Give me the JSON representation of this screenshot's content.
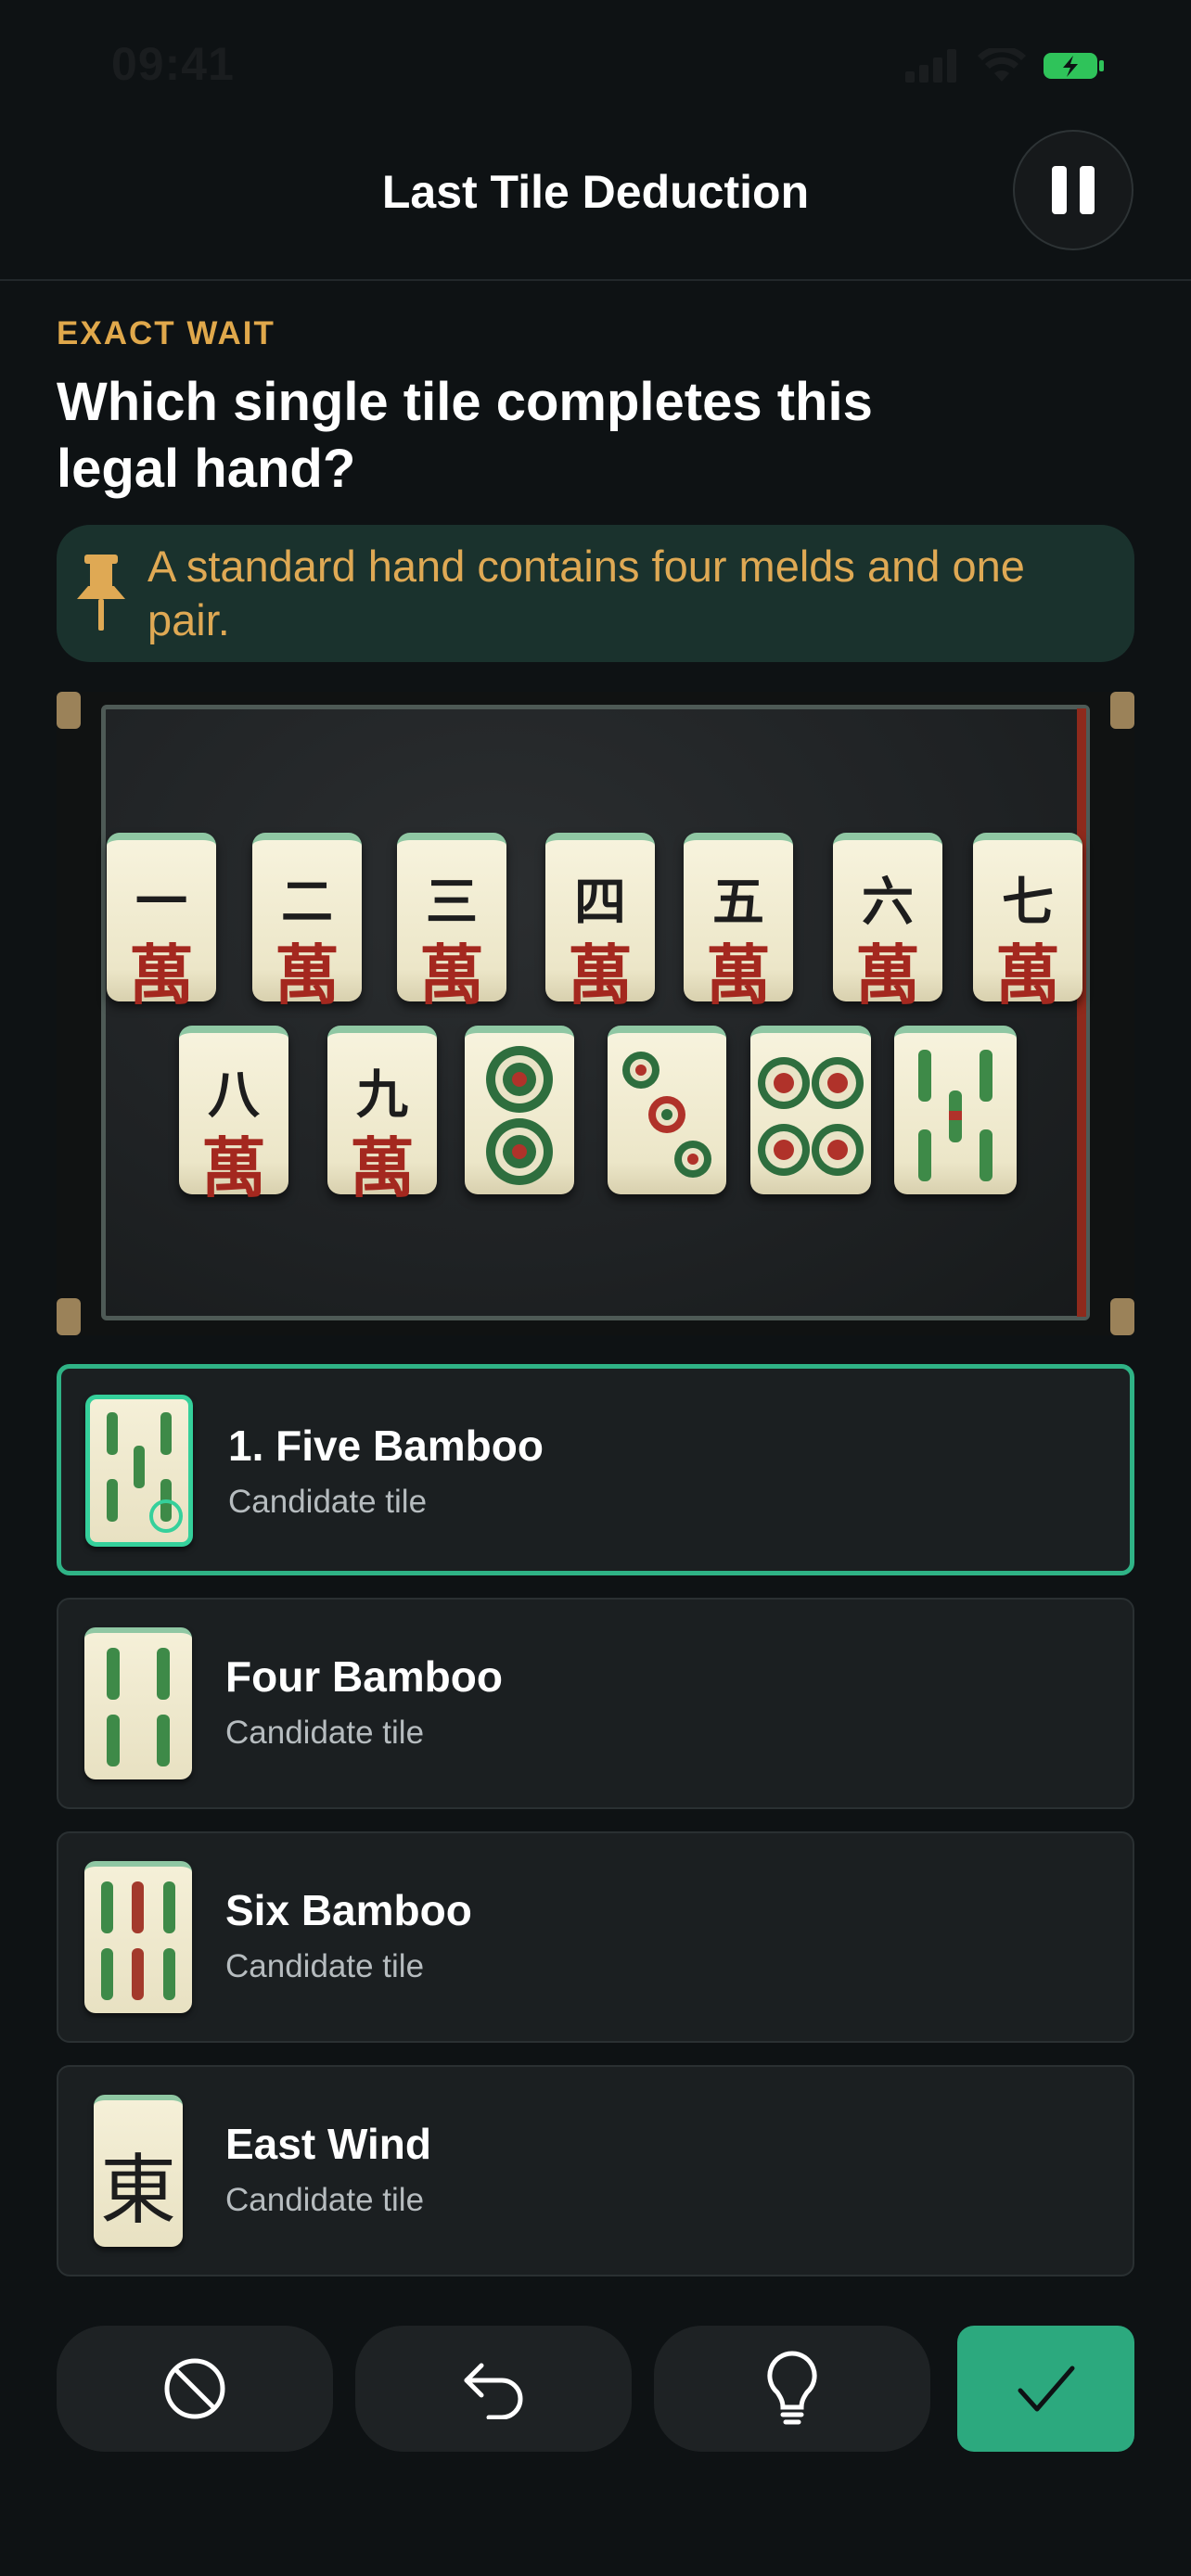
{
  "status_bar": {
    "time": "09:41"
  },
  "nav": {
    "title": "Last Tile Deduction",
    "pause_icon": "pause-icon"
  },
  "puzzle": {
    "eyebrow": "EXACT WAIT",
    "question": "Which single tile completes this legal hand?",
    "hint": "A standard hand contains four melds and one pair."
  },
  "hand": {
    "row1": [
      {
        "num": "一",
        "suit": "萬"
      },
      {
        "num": "二",
        "suit": "萬"
      },
      {
        "num": "三",
        "suit": "萬"
      },
      {
        "num": "四",
        "suit": "萬"
      },
      {
        "num": "五",
        "suit": "萬"
      },
      {
        "num": "六",
        "suit": "萬"
      },
      {
        "num": "七",
        "suit": "萬"
      }
    ],
    "row2": [
      {
        "num": "八",
        "suit": "萬"
      },
      {
        "num": "九",
        "suit": "萬"
      },
      {
        "tile": "two-circles"
      },
      {
        "tile": "three-circles"
      },
      {
        "tile": "four-circles"
      },
      {
        "tile": "five-bamboo"
      }
    ]
  },
  "options": [
    {
      "title": "1. Five Bamboo",
      "subtitle": "Candidate tile",
      "tile": "five-bamboo",
      "selected": true
    },
    {
      "title": "Four Bamboo",
      "subtitle": "Candidate tile",
      "tile": "four-bamboo",
      "selected": false
    },
    {
      "title": "Six Bamboo",
      "subtitle": "Candidate tile",
      "tile": "six-bamboo",
      "selected": false
    },
    {
      "title": "East Wind",
      "subtitle": "Candidate tile",
      "tile": "east-wind",
      "tile_char": "東",
      "selected": false
    }
  ],
  "toolbar": {
    "buttons": [
      "clear-icon",
      "undo-icon",
      "hint-bulb-icon",
      "checkmark-icon"
    ]
  },
  "colors": {
    "accent": "#2ca97e",
    "gold": "#e0a84b",
    "hint_bg": "#1a322d",
    "background": "#0e1214"
  }
}
